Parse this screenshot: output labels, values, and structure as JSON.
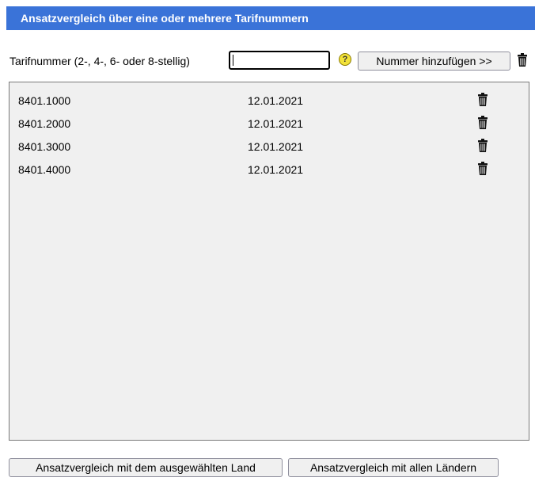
{
  "header": {
    "title": "Ansatzvergleich über eine oder mehrere Tarifnummern"
  },
  "input_row": {
    "label": "Tarifnummer (2-, 4-, 6- oder 8-stellig)",
    "input_value": "",
    "help_icon": "question-icon",
    "help_glyph": "?",
    "add_button": "Nummer hinzufügen >>",
    "delete_icon": "trash-icon"
  },
  "list": {
    "rows": [
      {
        "number": "8401.1000",
        "date": "12.01.2021"
      },
      {
        "number": "8401.2000",
        "date": "12.01.2021"
      },
      {
        "number": "8401.3000",
        "date": "12.01.2021"
      },
      {
        "number": "8401.4000",
        "date": "12.01.2021"
      }
    ],
    "row_icon": "trash-icon"
  },
  "footer": {
    "compare_selected_button": "Ansatzvergleich mit dem ausgewählten Land",
    "compare_all_button": "Ansatzvergleich mit allen Ländern"
  }
}
